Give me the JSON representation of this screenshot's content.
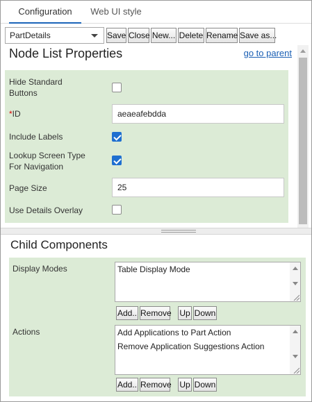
{
  "tabs": [
    {
      "label": "Configuration",
      "active": true
    },
    {
      "label": "Web UI style",
      "active": false
    }
  ],
  "toolbar": {
    "component_select": "PartDetails",
    "buttons": [
      "Save",
      "Close",
      "New...",
      "Delete",
      "Rename",
      "Save as..."
    ]
  },
  "node_list": {
    "title": "Node List Properties",
    "goto_parent": "go to parent",
    "hide_standard_buttons": {
      "label_line1": "Hide Standard",
      "label_line2": "Buttons",
      "checked": false
    },
    "id": {
      "required_mark": "*",
      "label": "ID",
      "value": "aeaeafebdda"
    },
    "include_labels": {
      "label": "Include Labels",
      "checked": true
    },
    "lookup_screen_type": {
      "label_line1": "Lookup Screen Type",
      "label_line2": "For Navigation",
      "checked": true
    },
    "page_size": {
      "label": "Page Size",
      "value": "25"
    },
    "use_details_overlay": {
      "label": "Use Details Overlay",
      "checked": false
    }
  },
  "child_components": {
    "title": "Child Components",
    "display_modes": {
      "label": "Display Modes",
      "items": [
        "Table Display Mode"
      ]
    },
    "actions": {
      "label": "Actions",
      "items": [
        "Add Applications to Part Action",
        "Remove Application Suggestions Action"
      ]
    },
    "buttons": {
      "add": "Add..",
      "remove": "Remove",
      "up": "Up",
      "down": "Down"
    }
  },
  "colors": {
    "accent": "#1a64b8",
    "panel_green": "#dcebd6",
    "link": "#1a5fb4",
    "checkbox_on": "#1f6fd0"
  }
}
